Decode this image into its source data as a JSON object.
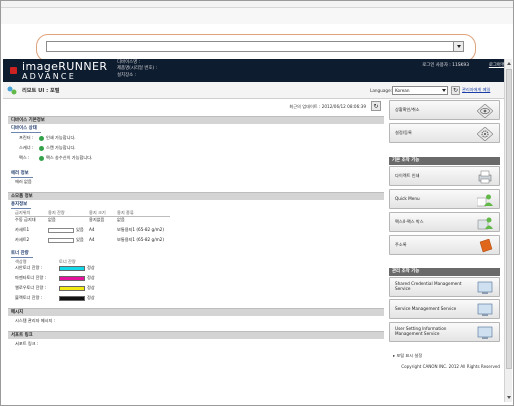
{
  "header": {
    "logo_line1": "imageRUNNER",
    "logo_line2": "ADVANCE",
    "device_name": "디바이스명 :",
    "product_name": "제품명(시리얼 번호) :",
    "location": "설치장소 :",
    "user": "로그인 사용자 : 11SK93",
    "logout": "로그아웃"
  },
  "subheader": {
    "title": "리모트 UI : 포털",
    "language_label": "Language:",
    "language_value": "Korean",
    "mail_link": "관리자에게 메일"
  },
  "main": {
    "last_updated": "최근의 업데이트 : 2012/06/12 08:06:39",
    "device_status": {
      "title": "디바이스 기본정보",
      "sub": "디바이스 상태",
      "rows": [
        {
          "label": "프린터 :",
          "value": "인쇄 가능합니다."
        },
        {
          "label": "스캐너 :",
          "value": "스캔 가능합니다."
        },
        {
          "label": "팩스 :",
          "value": "팩스 송수신이 가능합니다."
        }
      ]
    },
    "error": {
      "sub": "에러 정보",
      "value": "에러 없음"
    },
    "consumables": {
      "title": "소모품 정보",
      "paper_sub": "용지정보",
      "headers": [
        "급지위치",
        "용지 잔량",
        "용지 크기",
        "용지 종류"
      ],
      "rows": [
        {
          "source": "수동 급지대",
          "remain": "없음",
          "size": "용지없음",
          "type": "없음"
        },
        {
          "source": "카세트1",
          "remain": "있음",
          "size": "A4",
          "type": "보통용지1 (65-82 g/m2)"
        },
        {
          "source": "카세트2",
          "remain": "있음",
          "size": "A4",
          "type": "보통용지1 (65-82 g/m2)"
        }
      ],
      "toner_sub": "토너 잔량",
      "toner_headers": [
        "색상명",
        "토너 잔량"
      ],
      "toner": [
        {
          "name": "시안토너 잔량 :",
          "status": "정상",
          "color": "#14d7e8"
        },
        {
          "name": "마젠타토너 잔량 :",
          "status": "정상",
          "color": "#e5139b"
        },
        {
          "name": "옐로우토너 잔량 :",
          "status": "정상",
          "color": "#f2ea12"
        },
        {
          "name": "블랙토너 잔량 :",
          "status": "정상",
          "color": "#111111"
        }
      ]
    },
    "message": {
      "title": "메시지",
      "value": "시스템 관리자 메시지 :"
    },
    "support": {
      "title": "서포트 링크",
      "value": "서포트 링크 :"
    }
  },
  "side": {
    "top_buttons": [
      "상황확인/취소",
      "설정/등록"
    ],
    "basic_title": "기본 조작 기능",
    "basic_buttons": [
      "다이렉트 인쇄",
      "Quick Menu",
      "팩스/I-팩스 박스",
      "주소록"
    ],
    "admin_title": "관리 조작 기능",
    "admin_buttons": [
      "Shared Credential Management Service",
      "Service Management Service",
      "User Setting Information Management Service"
    ],
    "footer_link": "포털 표시 설정",
    "copyright": "Copyright CANON INC. 2012 All Rights Reserved"
  },
  "colors": {
    "header": "#0e1c30",
    "accent_red": "#cc2222",
    "link": "#1a3fa6"
  }
}
